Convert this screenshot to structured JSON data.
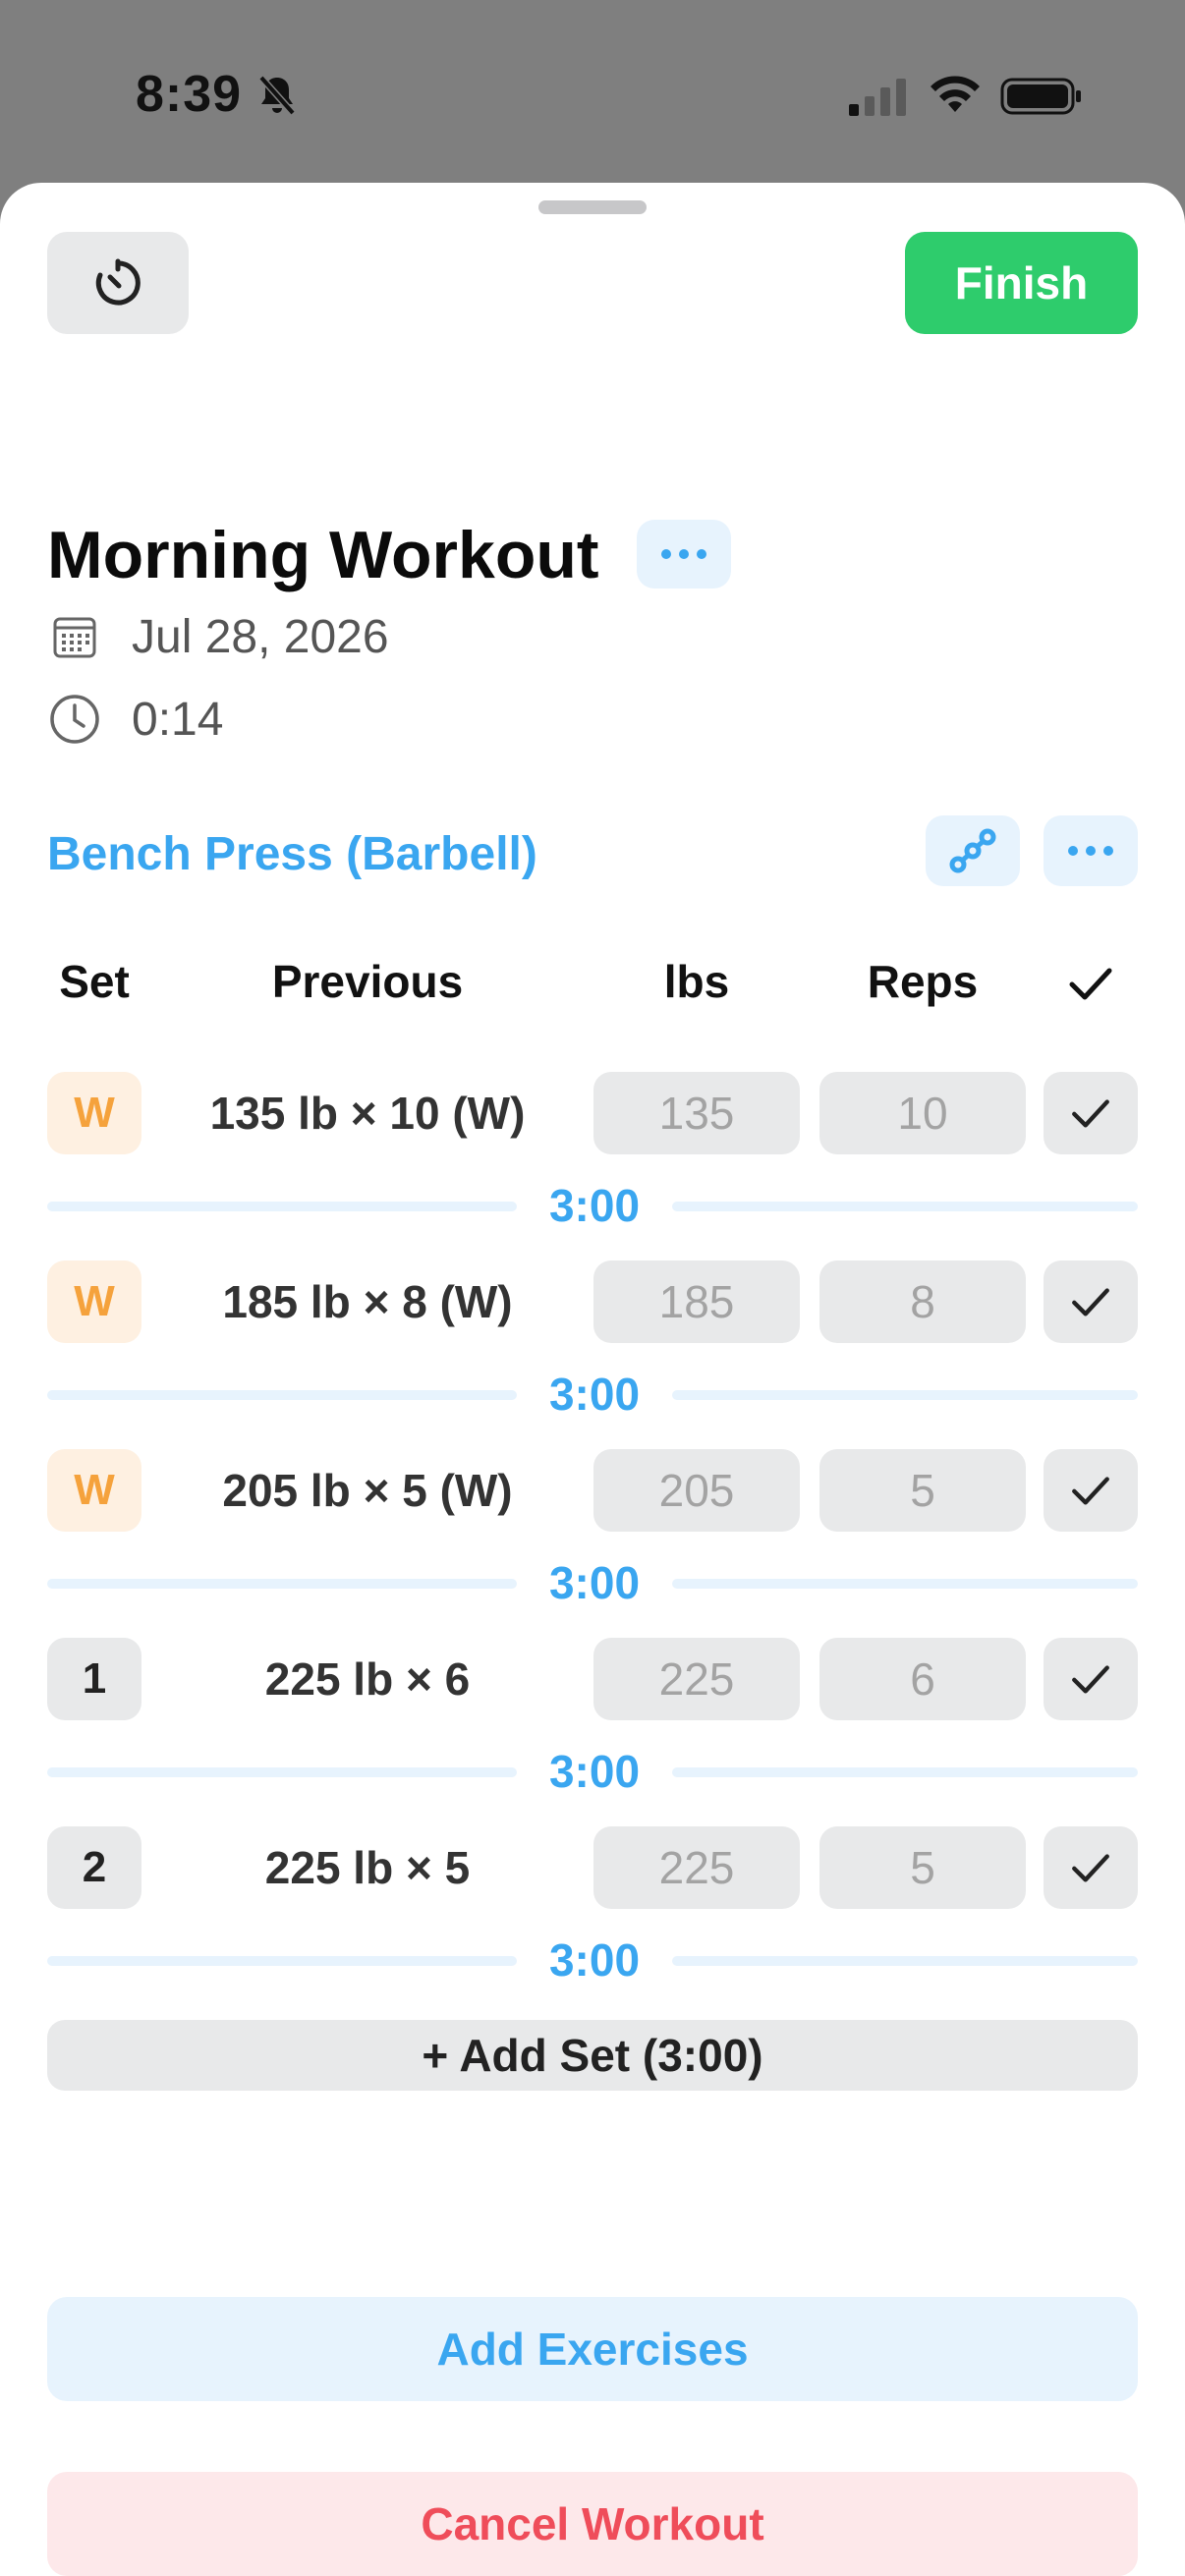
{
  "status_bar": {
    "time": "8:39",
    "icons": [
      "bell-slash-icon",
      "cellular-signal-icon",
      "wifi-icon",
      "battery-icon"
    ]
  },
  "header": {
    "timer_icon": "timer-icon",
    "finish_label": "Finish"
  },
  "workout": {
    "title": "Morning Workout",
    "date": "Jul 28, 2026",
    "duration": "0:14"
  },
  "exercise": {
    "name": "Bench Press (Barbell)",
    "columns": {
      "set": "Set",
      "previous": "Previous",
      "weight": "lbs",
      "reps": "Reps"
    },
    "sets": [
      {
        "label": "W",
        "type": "warmup",
        "previous": "135 lb × 10 (W)",
        "lbs": "135",
        "reps": "10",
        "rest": "3:00"
      },
      {
        "label": "W",
        "type": "warmup",
        "previous": "185 lb × 8 (W)",
        "lbs": "185",
        "reps": "8",
        "rest": "3:00"
      },
      {
        "label": "W",
        "type": "warmup",
        "previous": "205 lb × 5 (W)",
        "lbs": "205",
        "reps": "5",
        "rest": "3:00"
      },
      {
        "label": "1",
        "type": "normal",
        "previous": "225 lb × 6",
        "lbs": "225",
        "reps": "6",
        "rest": "3:00"
      },
      {
        "label": "2",
        "type": "normal",
        "previous": "225 lb × 5",
        "lbs": "225",
        "reps": "5",
        "rest": "3:00"
      }
    ],
    "add_set_label": "+ Add Set (3:00)"
  },
  "actions": {
    "add_exercises": "Add Exercises",
    "cancel_workout": "Cancel Workout"
  },
  "colors": {
    "accent": "#3aa6f0",
    "finish": "#2ecc6c",
    "warmup": "#f5a23c",
    "danger": "#ef4d5a"
  }
}
